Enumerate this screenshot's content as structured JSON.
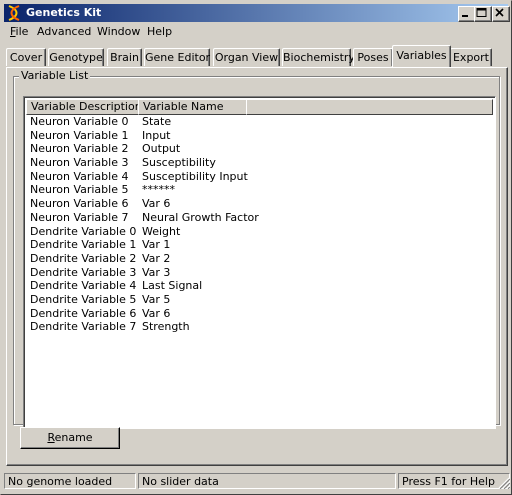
{
  "window": {
    "title": "Genetics Kit"
  },
  "menu": [
    {
      "label": "File",
      "accel": "F",
      "rest": "ile"
    },
    {
      "label": "Advanced",
      "accel": "",
      "rest": "Advanced"
    },
    {
      "label": "Window",
      "accel": "",
      "rest": "Window"
    },
    {
      "label": "Help",
      "accel": "",
      "rest": "Help"
    }
  ],
  "tabs": [
    {
      "label": "Cover"
    },
    {
      "label": "Genotype"
    },
    {
      "label": "Brain"
    },
    {
      "label": "Gene Editor"
    },
    {
      "label": "Organ View"
    },
    {
      "label": "Biochemistry"
    },
    {
      "label": "Poses"
    },
    {
      "label": "Variables",
      "active": true
    },
    {
      "label": "Export"
    }
  ],
  "groupbox": {
    "label": "Variable List"
  },
  "listview": {
    "columns": [
      "Variable Description",
      "Variable Name",
      ""
    ],
    "rows": [
      {
        "desc": "Neuron Variable  0",
        "name": "State"
      },
      {
        "desc": "Neuron Variable  1",
        "name": "Input"
      },
      {
        "desc": "Neuron Variable  2",
        "name": "Output"
      },
      {
        "desc": "Neuron Variable  3",
        "name": "Susceptibility"
      },
      {
        "desc": "Neuron Variable  4",
        "name": "Susceptibility Input"
      },
      {
        "desc": "Neuron Variable  5",
        "name": "******"
      },
      {
        "desc": "Neuron Variable  6",
        "name": "Var  6"
      },
      {
        "desc": "Neuron Variable  7",
        "name": "Neural Growth Factor"
      },
      {
        "desc": "Dendrite Variable  0",
        "name": "Weight"
      },
      {
        "desc": "Dendrite Variable  1",
        "name": "Var  1"
      },
      {
        "desc": "Dendrite Variable  2",
        "name": "Var  2"
      },
      {
        "desc": "Dendrite Variable  3",
        "name": "Var  3"
      },
      {
        "desc": "Dendrite Variable  4",
        "name": "Last Signal"
      },
      {
        "desc": "Dendrite Variable  5",
        "name": "Var  5"
      },
      {
        "desc": "Dendrite Variable  6",
        "name": "Var  6"
      },
      {
        "desc": "Dendrite Variable  7",
        "name": "Strength"
      }
    ]
  },
  "buttons": {
    "rename_accel": "R",
    "rename_rest": "ename"
  },
  "status": {
    "pane1": "No genome loaded",
    "pane2": "No slider data",
    "pane3": "Press F1 for Help"
  },
  "colors": {
    "titlebar_start": "#0a246a",
    "titlebar_end": "#a6caf0",
    "face": "#d4d0c8"
  },
  "icons": {
    "app": "dna-helix-icon",
    "minimize": "minimize-icon",
    "maximize": "maximize-icon",
    "close": "close-icon"
  }
}
